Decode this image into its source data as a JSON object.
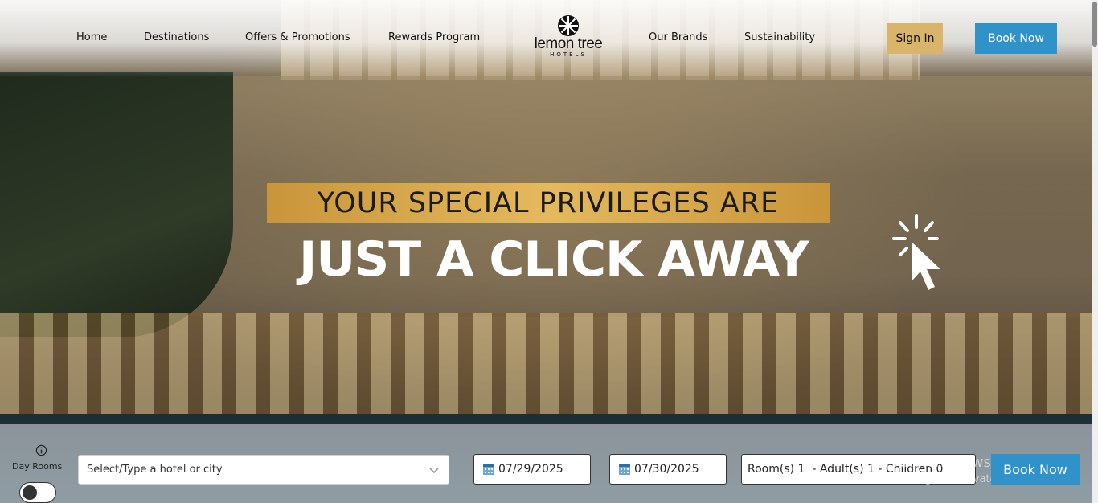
{
  "nav": {
    "links": [
      "Home",
      "Destinations",
      "Offers & Promotions",
      "Rewards Program",
      "Our Brands",
      "Sustainability"
    ],
    "sign_in": "Sign In",
    "book_now": "Book Now"
  },
  "logo": {
    "brand": "lemon tree",
    "sub": "HOTELS"
  },
  "hero": {
    "headline_top": "YOUR SPECIAL PRIVILEGES ARE",
    "headline_main": "JUST A CLICK AWAY"
  },
  "booking": {
    "day_rooms_label": "Day Rooms",
    "hotel_placeholder": "Select/Type a hotel or city",
    "check_in": "07/29/2025",
    "check_out": "07/30/2025",
    "rooms_summary": "Room(s) 1  - Adult(s) 1 - Children 0",
    "book_now": "Book Now"
  },
  "watermark": {
    "line1": "Activate Windows",
    "line2": "Go to Settings to activate Windows."
  },
  "colors": {
    "gold": "#d9b56c",
    "blue": "#2f92c9"
  },
  "icons": [
    "info-icon",
    "calendar-icon",
    "chevron-down-icon",
    "cursor-click-icon",
    "lemon-tree-logo-icon"
  ]
}
